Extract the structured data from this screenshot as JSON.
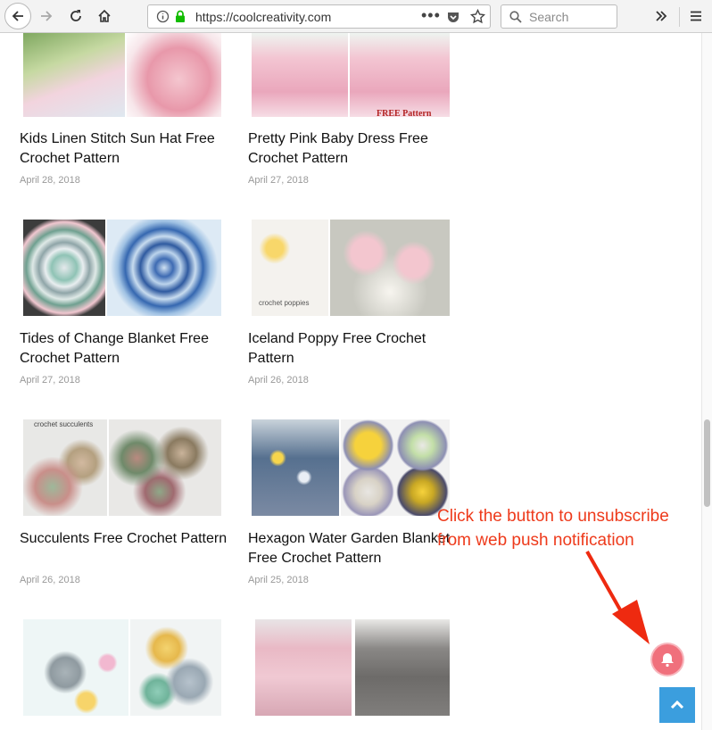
{
  "browser": {
    "url": "https://coolcreativity.com",
    "search_placeholder": "Search",
    "icons": [
      "back-icon",
      "forward-icon",
      "reload-icon",
      "home-icon",
      "info-icon",
      "lock-icon",
      "more-icon",
      "pocket-icon",
      "bookmark-star-icon",
      "search-icon",
      "overflow-icon",
      "menu-icon"
    ]
  },
  "posts": [
    {
      "title": "Kids Linen Stitch Sun Hat Free Crochet Pattern",
      "date": "April 28, 2018"
    },
    {
      "title": "Pretty Pink Baby Dress Free Crochet Pattern",
      "date": "April 27, 2018",
      "image_caption": "FREE Pattern"
    },
    {
      "title": "Tides of Change Blanket Free Crochet Pattern",
      "date": "April 27, 2018"
    },
    {
      "title": "Iceland Poppy Free Crochet Pattern",
      "date": "April 26, 2018",
      "image_caption": "crochet poppies"
    },
    {
      "title": "Succulents Free Crochet Pattern",
      "date": "April 26, 2018",
      "image_caption": "crochet succulents"
    },
    {
      "title": "Hexagon Water Garden Blanket Free Crochet Pattern",
      "date": "April 25, 2018"
    },
    {
      "title": "",
      "date": ""
    },
    {
      "title": "",
      "date": ""
    }
  ],
  "annotation": {
    "text": "Click the button to unsubscribe from web push notification",
    "color": "#ee3a1b"
  },
  "widgets": {
    "notification_bell_color": "#f0707c",
    "scroll_top_color": "#3b9ede"
  }
}
